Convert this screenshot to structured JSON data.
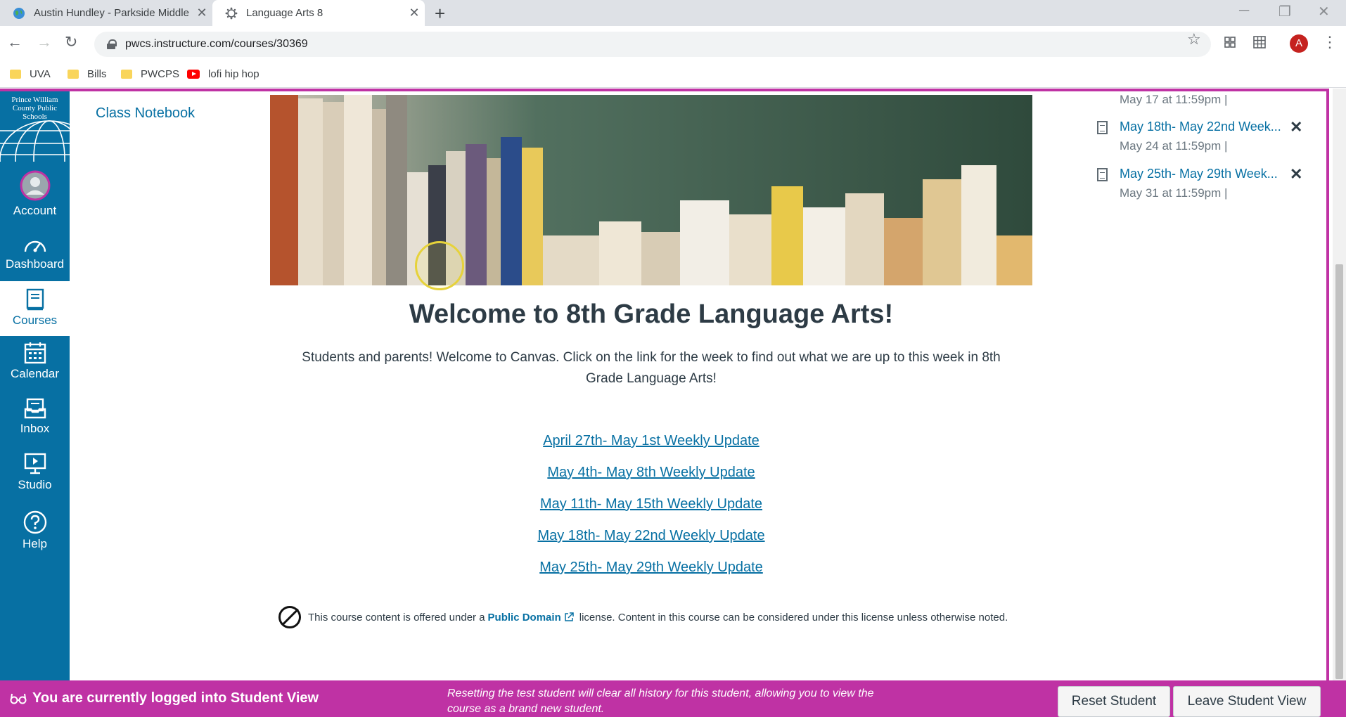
{
  "browser": {
    "tabs": [
      {
        "title": "Austin Hundley - Parkside Middle",
        "active": false,
        "icon": "globe-icon"
      },
      {
        "title": "Language Arts 8",
        "active": true,
        "icon": "canvas-icon"
      }
    ],
    "new_tab": "+",
    "url": "pwcs.instructure.com/courses/30369",
    "profile_initial": "A",
    "bookmarks": [
      {
        "label": "UVA",
        "icon": "folder-icon"
      },
      {
        "label": "Bills",
        "icon": "folder-icon"
      },
      {
        "label": "PWCPS",
        "icon": "folder-icon"
      },
      {
        "label": "lofi hip hop",
        "icon": "youtube-icon"
      }
    ]
  },
  "global_nav": {
    "logo_text": "Prince William County Public Schools",
    "items": [
      {
        "label": "Account",
        "icon": "account-avatar-icon"
      },
      {
        "label": "Dashboard",
        "icon": "dashboard-icon"
      },
      {
        "label": "Courses",
        "icon": "courses-icon",
        "active": true
      },
      {
        "label": "Calendar",
        "icon": "calendar-icon"
      },
      {
        "label": "Inbox",
        "icon": "inbox-icon"
      },
      {
        "label": "Studio",
        "icon": "studio-icon"
      },
      {
        "label": "Help",
        "icon": "help-icon"
      }
    ]
  },
  "course_nav": {
    "items": [
      "Class Notebook"
    ]
  },
  "main": {
    "heading": "Welcome to 8th Grade Language Arts!",
    "intro": "Students and parents!  Welcome to Canvas.  Click on the link for the week to find out what we are up to this week in 8th Grade Language Arts!",
    "weekly_links": [
      "April 27th- May 1st Weekly Update",
      "May 4th- May 8th Weekly Update",
      "May 11th- May 15th Weekly Update",
      "May 18th- May 22nd Weekly Update",
      "May 25th- May 29th Weekly Update"
    ],
    "license": {
      "prefix": "This course content is offered under a",
      "link": "Public Domain",
      "suffix": "license. Content in this course can be considered under this license unless otherwise noted."
    }
  },
  "todo": {
    "partial_date": "May 17 at 11:59pm  |",
    "items": [
      {
        "title": "May 18th- May 22nd Week...",
        "date": "May 24 at 11:59pm  |"
      },
      {
        "title": "May 25th- May 29th Week...",
        "date": "May 31 at 11:59pm  |"
      }
    ]
  },
  "student_view": {
    "message": "You are currently logged into Student View",
    "note": "Resetting the test student will clear all history for this student, allowing you to view the course as a brand new student.",
    "reset_label": "Reset Student",
    "leave_label": "Leave Student View",
    "color": "#bf32a4"
  },
  "colors": {
    "canvas_blue": "#0770a3",
    "student_magenta": "#bf32a4"
  }
}
